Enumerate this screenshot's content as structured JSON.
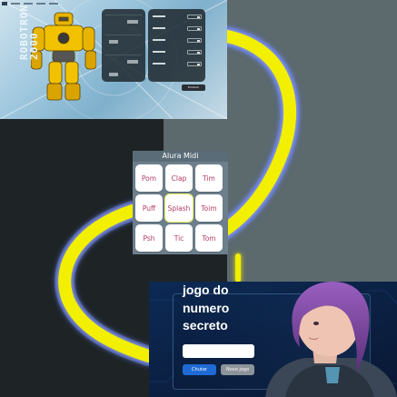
{
  "robotron": {
    "title_line1": "ROBOTRON",
    "title_line2": "2000",
    "button_label": "Produzir"
  },
  "midi": {
    "title": "Alura Midi",
    "keys": [
      {
        "label": "Pom"
      },
      {
        "label": "Clap"
      },
      {
        "label": "Tim"
      },
      {
        "label": "Puff"
      },
      {
        "label": "Splash"
      },
      {
        "label": "Toim"
      },
      {
        "label": "Psh"
      },
      {
        "label": "Tic"
      },
      {
        "label": "Tom"
      }
    ]
  },
  "jogo": {
    "title": "jogo do numero secreto",
    "guess_button": "Chutar",
    "new_game_button": "Novo jogo"
  },
  "colors": {
    "loop_yellow": "#f2f000",
    "midi_key_text": "#b43a64",
    "chutar_blue": "#1e6bd6"
  }
}
